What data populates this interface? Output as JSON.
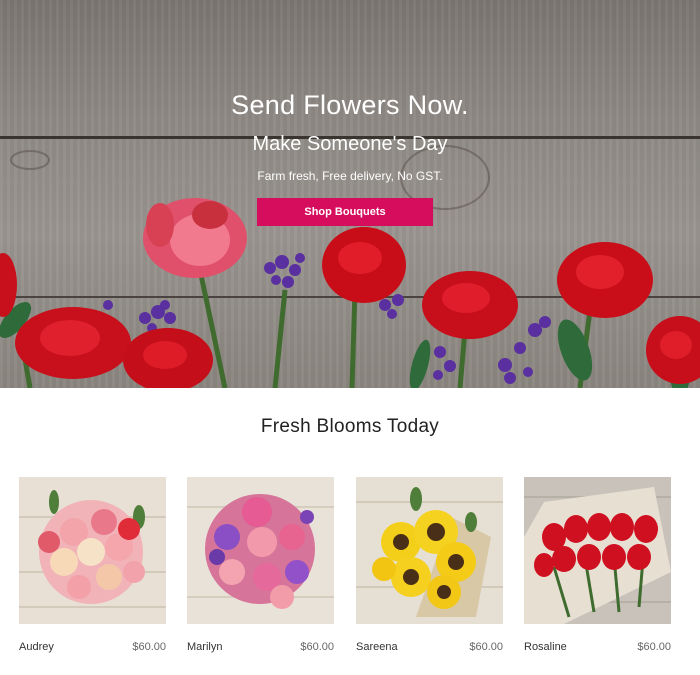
{
  "hero": {
    "title": "Send Flowers Now.",
    "subtitle": "Make Someone's Day",
    "tagline": "Farm fresh, Free delivery, No GST.",
    "cta_label": "Shop Bouquets",
    "accent_color": "#d60d5c"
  },
  "section": {
    "title": "Fresh Blooms Today"
  },
  "products": [
    {
      "name": "Audrey",
      "price": "$60.00"
    },
    {
      "name": "Marilyn",
      "price": "$60.00"
    },
    {
      "name": "Sareena",
      "price": "$60.00"
    },
    {
      "name": "Rosaline",
      "price": "$60.00"
    }
  ]
}
